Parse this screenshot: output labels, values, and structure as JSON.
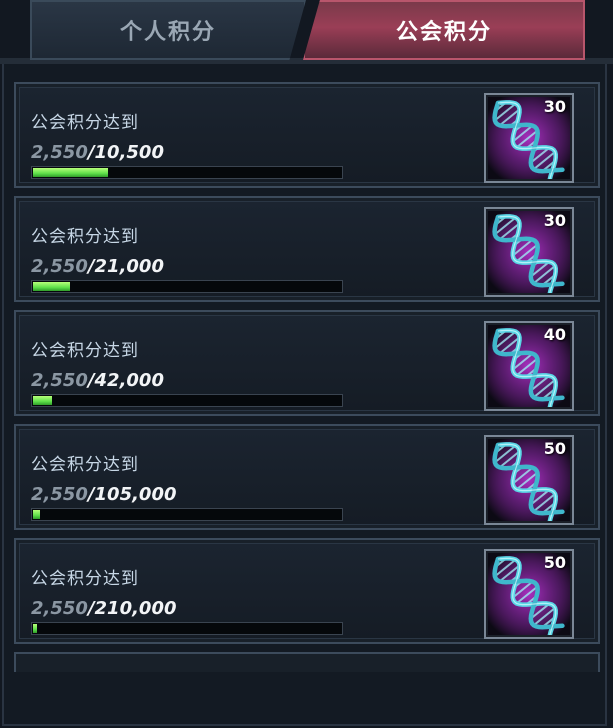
{
  "tabs": {
    "personal": "个人积分",
    "guild": "公会积分",
    "active": "guild"
  },
  "colors": {
    "accent_tab": "#9a3e56",
    "progress_green": "#5fe04a",
    "dna_cyan": "#5ad6e6",
    "dna_glow": "#b030c8"
  },
  "milestones": [
    {
      "label": "公会积分达到",
      "current": "2,550",
      "target": "10,500",
      "progress": 0.243,
      "reward_icon": "dna-helix-icon",
      "reward_count": "30"
    },
    {
      "label": "公会积分达到",
      "current": "2,550",
      "target": "21,000",
      "progress": 0.121,
      "reward_icon": "dna-helix-icon",
      "reward_count": "30"
    },
    {
      "label": "公会积分达到",
      "current": "2,550",
      "target": "42,000",
      "progress": 0.061,
      "reward_icon": "dna-helix-icon",
      "reward_count": "40"
    },
    {
      "label": "公会积分达到",
      "current": "2,550",
      "target": "105,000",
      "progress": 0.024,
      "reward_icon": "dna-helix-icon",
      "reward_count": "50"
    },
    {
      "label": "公会积分达到",
      "current": "2,550",
      "target": "210,000",
      "progress": 0.012,
      "reward_icon": "dna-helix-icon",
      "reward_count": "50"
    }
  ]
}
